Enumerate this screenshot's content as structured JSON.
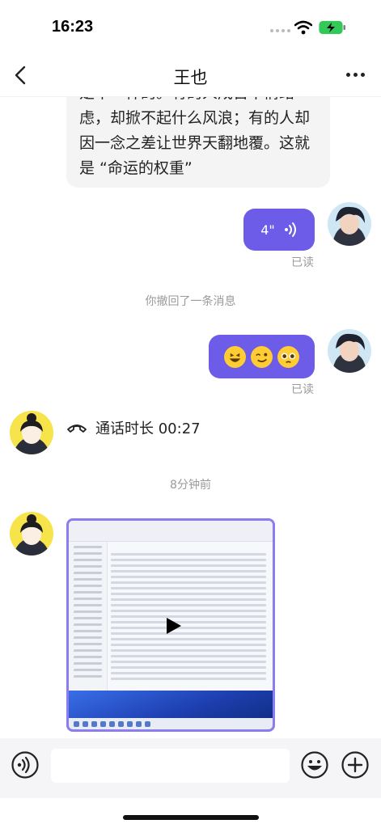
{
  "status_bar": {
    "time": "16:23"
  },
  "header": {
    "title": "王也"
  },
  "messages": {
    "text_lines": [
      "是平一样的。有的人成百千情绪",
      "虑，却掀不起什么风浪；有的人却",
      "因一念之差让世界天翻地覆。这就",
      "是 “命运的权重”"
    ],
    "voice_duration": "4\"",
    "read_label_1": "已读",
    "recall_notice": "你撤回了一条消息",
    "read_label_2": "已读",
    "call_text": "通话时长 00:27",
    "time_divider": "8分钟前"
  },
  "colors": {
    "accent": "#6c5ce7",
    "bubble_gray": "#f4f4f4",
    "meta_text": "#9a9a9a"
  }
}
